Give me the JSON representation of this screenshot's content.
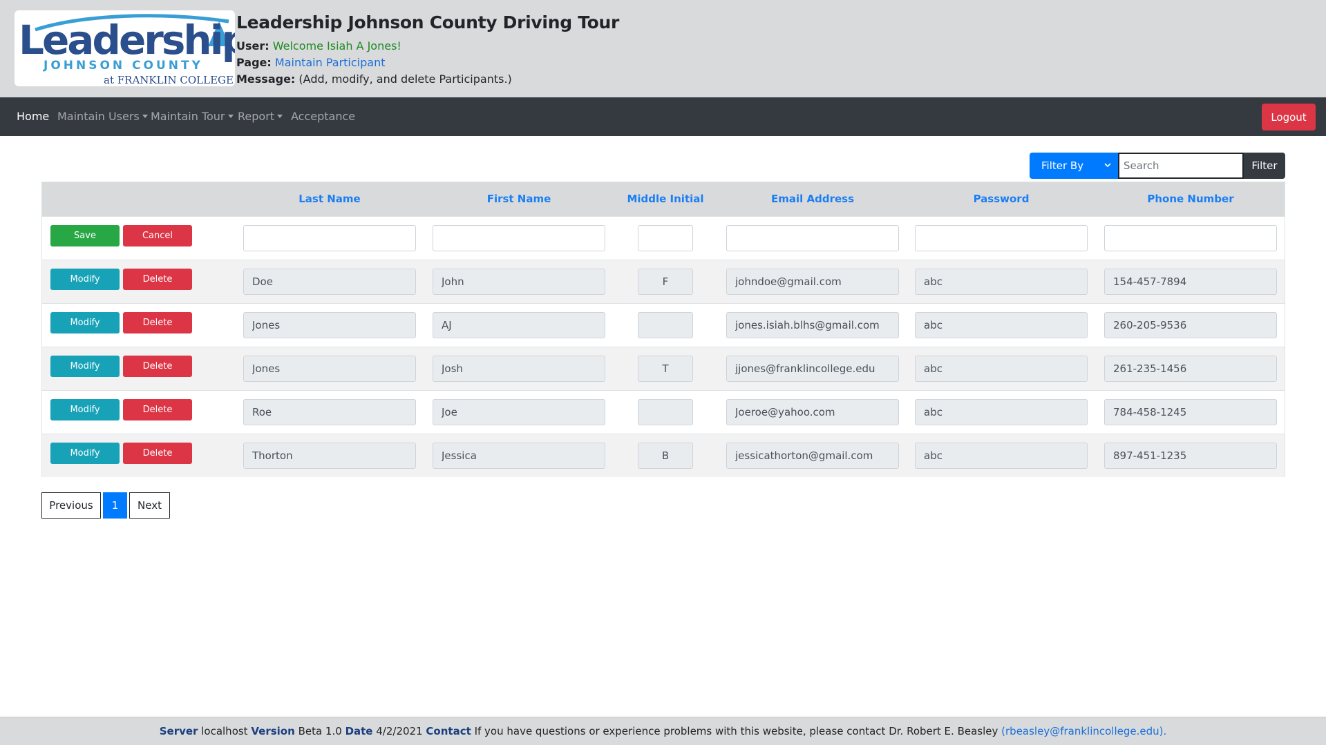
{
  "header": {
    "logo_main": "Leadership",
    "logo_county": "JOHNSON COUNTY",
    "logo_college": "at FRANKLIN COLLEGE",
    "title": "Leadership Johnson County Driving Tour",
    "user_label": "User:",
    "user_value": "Welcome Isiah A Jones!",
    "page_label": "Page:",
    "page_value": "Maintain Participant",
    "message_label": "Message:",
    "message_value": "(Add, modify, and delete Participants.)"
  },
  "nav": {
    "items": [
      {
        "label": "Home",
        "active": true
      },
      {
        "label": "Maintain Users",
        "dropdown": true
      },
      {
        "label": "Maintain Tour",
        "dropdown": true
      },
      {
        "label": "Report",
        "dropdown": true
      },
      {
        "label": "Acceptance"
      }
    ],
    "logout_label": "Logout"
  },
  "filter": {
    "select_label": "Filter By",
    "search_placeholder": "Search",
    "button_label": "Filter"
  },
  "table": {
    "columns": [
      "Last Name",
      "First Name",
      "Middle Initial",
      "Email Address",
      "Password",
      "Phone Number"
    ],
    "edit_row": {
      "save_label": "Save",
      "cancel_label": "Cancel"
    },
    "modify_label": "Modify",
    "delete_label": "Delete",
    "rows": [
      {
        "last": "Doe",
        "first": "John",
        "mi": "F",
        "email": "johndoe@gmail.com",
        "password": "abc",
        "phone": "154-457-7894"
      },
      {
        "last": "Jones",
        "first": "AJ",
        "mi": "",
        "email": "jones.isiah.blhs@gmail.com",
        "password": "abc",
        "phone": "260-205-9536"
      },
      {
        "last": "Jones",
        "first": "Josh",
        "mi": "T",
        "email": "jjones@franklincollege.edu",
        "password": "abc",
        "phone": "261-235-1456"
      },
      {
        "last": "Roe",
        "first": "Joe",
        "mi": "",
        "email": "Joeroe@yahoo.com",
        "password": "abc",
        "phone": "784-458-1245"
      },
      {
        "last": "Thorton",
        "first": "Jessica",
        "mi": "B",
        "email": "jessicathorton@gmail.com",
        "password": "abc",
        "phone": "897-451-1235"
      }
    ]
  },
  "pagination": {
    "previous": "Previous",
    "current": "1",
    "next": "Next"
  },
  "footer": {
    "server_label": "Server",
    "server_value": "localhost",
    "version_label": "Version",
    "version_value": "Beta 1.0",
    "date_label": "Date",
    "date_value": "4/2/2021",
    "contact_label": "Contact",
    "contact_text": "If you have questions or experience problems with this website, please contact Dr. Robert E. Beasley",
    "contact_email": "(rbeasley@franklincollege.edu)."
  },
  "colors": {
    "header_bg": "#d9dadc",
    "navbar_bg": "#343a40",
    "primary": "#007bff",
    "danger": "#dc3545",
    "success": "#28a745",
    "info": "#17a2b8"
  }
}
